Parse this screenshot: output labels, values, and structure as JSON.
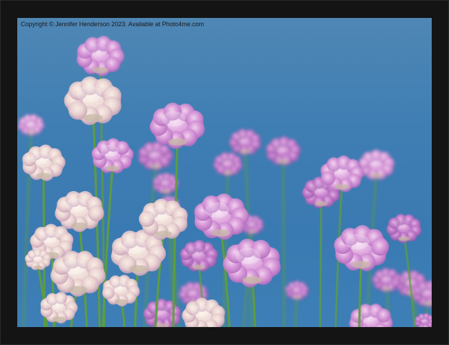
{
  "photo": {
    "copyright": "Copyright © Jennifer Henderson 2023. Available at Photo4me.com",
    "subject": "pink-sea-thrift-flowers"
  },
  "colors": {
    "frame": "#141414",
    "sky": "#3d7db4",
    "stem": "#5e9e3c",
    "petal": "#d28bd6",
    "petal_light": "#f1d6ec",
    "petal_pale": "#f4e8dc"
  }
}
